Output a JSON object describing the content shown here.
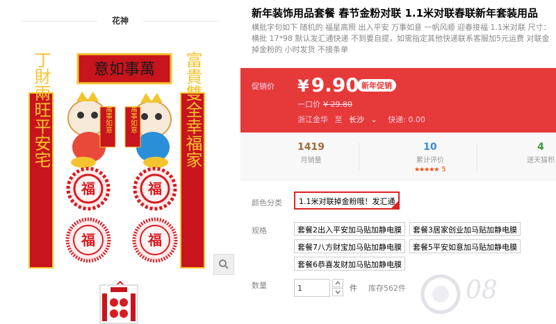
{
  "gallery": {
    "shop_name": "花神",
    "image": {
      "banner_text": "意如事萬",
      "left_couplet": "丁財兩旺平安宅",
      "right_couplet": "富貴雙全幸福家",
      "fu_char": "福",
      "scroll_left": "萬事如意",
      "scroll_right": "萬事如意"
    },
    "zoom_icon": "magnifier-icon",
    "up_icon": "chevron-up-icon"
  },
  "product": {
    "title": "新年装饰用品套餐 春节金粉对联 1.1米对联春联新年套装用品",
    "subtitle": "横批字句如下 随机的 福星高照 出入平安 万事如意 一帆风顺 迎春接福 1.1米对联 尺寸：横批 17*98 默认发汇通快递 不到要自提，如需指定其他快递联系客服加5元运费 对联金掉金粉的 小时发货 不接条单"
  },
  "price_box": {
    "label": "促销价",
    "currency": "¥",
    "price": "9.90",
    "tag": "新年促销",
    "orig_label": "一口价",
    "orig_price": "¥ 29.80",
    "ship_from": "浙江金华",
    "ship_to_label": "至",
    "ship_dest": "长沙",
    "dest_caret": "⌄",
    "delivery": "快递: 0.00"
  },
  "stats": {
    "monthly_sales": {
      "value": "1419",
      "label": "月销量"
    },
    "reviews": {
      "value": "10",
      "label": "累计评价",
      "stars": "★★★★★",
      "score": "5"
    },
    "tmall_points": {
      "value": "4",
      "label": "送天猫积"
    }
  },
  "options": {
    "color_label": "颜色分类",
    "color_selected": "1.1米对联掉金粉哦！发汇通",
    "spec_label": "规格",
    "specs": [
      "套餐2出入平安加马贴加静电膜",
      "套餐3居家创业加马贴加静电膜",
      "套餐7八方财宝加马贴加静电膜",
      "套餐5平安如意加马贴加静电膜",
      "套餐6恭喜发财加马贴加静电膜"
    ],
    "qty_label": "数量",
    "qty_value": "1",
    "qty_unit": "件",
    "stock": "库存562件"
  },
  "watermark": {
    "text": "08"
  },
  "colors": {
    "accent": "#e5393a",
    "couplet_red": "#c8141c",
    "gold": "#f4c430"
  }
}
